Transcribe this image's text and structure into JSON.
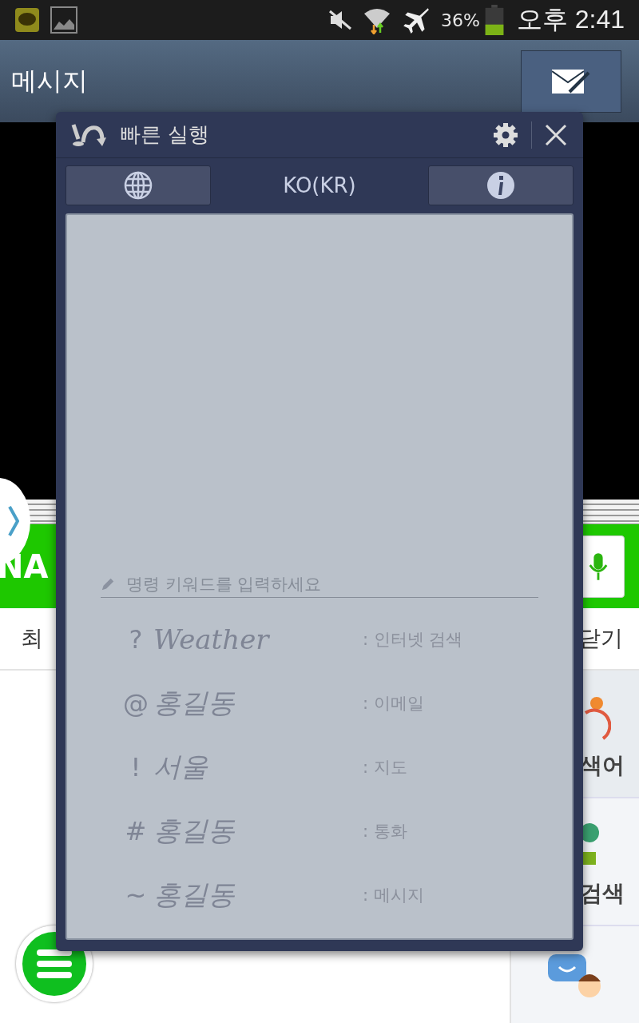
{
  "status_bar": {
    "battery_percent": "36%",
    "time": "오후 2:41"
  },
  "app_bar": {
    "title": "메시지"
  },
  "browser": {
    "logo": "NA",
    "tabs": [
      "최",
      "닫기"
    ],
    "side_items": [
      "색어",
      "검색"
    ]
  },
  "quick_command": {
    "title": "빠른 실행",
    "language": "KO(KR)",
    "input": {
      "placeholder": "명령 키워드를 입력하세요"
    },
    "examples": [
      {
        "symbol": "?",
        "keyword": "Weather",
        "action": ": 인터넷 검색"
      },
      {
        "symbol": "@",
        "keyword": "홍길동",
        "action": ": 이메일"
      },
      {
        "symbol": "!",
        "keyword": "서울",
        "action": ": 지도"
      },
      {
        "symbol": "#",
        "keyword": "홍길동",
        "action": ": 통화"
      },
      {
        "symbol": "~",
        "keyword": "홍길동",
        "action": ": 메시지"
      }
    ]
  }
}
